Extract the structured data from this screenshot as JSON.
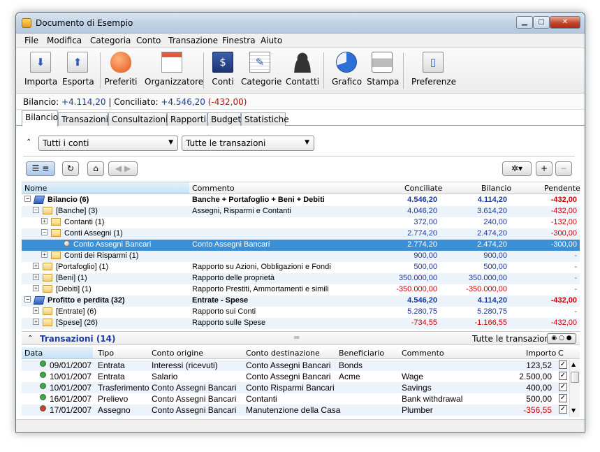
{
  "window": {
    "title": "Documento di Esempio"
  },
  "menu": [
    "File",
    "Modifica",
    "Categoria",
    "Conto",
    "Transazione",
    "Finestra",
    "Aiuto"
  ],
  "toolbar": [
    {
      "label": "Importa",
      "icon": "import-icon"
    },
    {
      "label": "Esporta",
      "icon": "export-icon"
    },
    {
      "label": "Preferiti",
      "icon": "heart-icon"
    },
    {
      "label": "Organizzatore",
      "icon": "calendar-icon"
    },
    {
      "label": "Conti",
      "icon": "accounts-book-icon"
    },
    {
      "label": "Categorie",
      "icon": "notepad-icon"
    },
    {
      "label": "Contatti",
      "icon": "person-icon"
    },
    {
      "label": "Grafico",
      "icon": "pie-chart-icon"
    },
    {
      "label": "Stampa",
      "icon": "printer-icon"
    },
    {
      "label": "Preferenze",
      "icon": "switch-icon"
    }
  ],
  "balance": {
    "label1": "Bilancio:",
    "value1": "+4.114,20",
    "sep": "|",
    "label2": "Conciliato:",
    "value2": "+4.546,20",
    "diff": "(-432,00)"
  },
  "tabs": [
    "Bilancio",
    "Transazioni",
    "Consultazioni",
    "Rapporti",
    "Budget",
    "Statistiche"
  ],
  "filters": {
    "accounts": "Tutti i conti",
    "transactions": "Tutte le transazioni"
  },
  "accounts": {
    "columns": [
      "Nome",
      "Commento",
      "Conciliate",
      "Bilancio",
      "Pendente"
    ],
    "rows": [
      {
        "name": "Bilancio (6)",
        "comment": "Banche + Portafoglio + Beni + Debiti",
        "conc": "4.546,20",
        "bal": "4.114,20",
        "pend": "-432,00",
        "bold": true,
        "indent": 0,
        "type": "book",
        "tog": "−"
      },
      {
        "name": "[Banche] (3)",
        "comment": "Assegni, Risparmi e Contanti",
        "conc": "4.046,20",
        "bal": "3.614,20",
        "pend": "-432,00",
        "indent": 1,
        "type": "folder",
        "tog": "−"
      },
      {
        "name": "Contanti (1)",
        "comment": "",
        "conc": "372,00",
        "bal": "240,00",
        "pend": "-132,00",
        "indent": 2,
        "type": "folder",
        "tog": "+"
      },
      {
        "name": "Conti Assegni (1)",
        "comment": "",
        "conc": "2.774,20",
        "bal": "2.474,20",
        "pend": "-300,00",
        "indent": 2,
        "type": "folder",
        "tog": "−"
      },
      {
        "name": "Conto Assegni Bancari",
        "comment": "Conto Assegni Bancari",
        "conc": "2.774,20",
        "bal": "2.474,20",
        "pend": "-300,00",
        "indent": 3,
        "type": "dot",
        "sel": true
      },
      {
        "name": "Conti dei Risparmi (1)",
        "comment": "",
        "conc": "900,00",
        "bal": "900,00",
        "pend": "-",
        "indent": 2,
        "type": "folder",
        "tog": "+"
      },
      {
        "name": "[Portafoglio] (1)",
        "comment": "Rapporto su Azioni, Obbligazioni e Fondi",
        "conc": "500,00",
        "bal": "500,00",
        "pend": "-",
        "indent": 1,
        "type": "folder",
        "tog": "+"
      },
      {
        "name": "[Beni] (1)",
        "comment": "Rapporto delle proprietà",
        "conc": "350.000,00",
        "bal": "350.000,00",
        "pend": "-",
        "indent": 1,
        "type": "folder",
        "tog": "+"
      },
      {
        "name": "[Debiti] (1)",
        "comment": "Rapporto Prestiti, Ammortamenti e simili",
        "conc": "-350.000,00",
        "bal": "-350.000,00",
        "pend": "-",
        "indent": 1,
        "type": "folder",
        "tog": "+",
        "neg": true
      },
      {
        "name": "Profitto e perdita (32)",
        "comment": "Entrate - Spese",
        "conc": "4.546,20",
        "bal": "4.114,20",
        "pend": "-432,00",
        "bold": true,
        "indent": 0,
        "type": "book",
        "tog": "−"
      },
      {
        "name": "[Entrate] (6)",
        "comment": "Rapporto sui Conti",
        "conc": "5.280,75",
        "bal": "5.280,75",
        "pend": "-",
        "indent": 1,
        "type": "folder",
        "tog": "+"
      },
      {
        "name": "[Spese] (26)",
        "comment": "Rapporto sulle Spese",
        "conc": "-734,55",
        "bal": "-1.166,55",
        "pend": "-432,00",
        "indent": 1,
        "type": "folder",
        "tog": "+",
        "neg": true
      }
    ]
  },
  "transactions": {
    "title": "Transazioni (14)",
    "filter": "Tutte le transazioni",
    "columns": [
      "Data",
      "Tipo",
      "Conto origine",
      "Conto destinazione",
      "Beneficiario",
      "Commento",
      "Importo",
      "C"
    ],
    "rows": [
      {
        "date": "09/01/2007",
        "type": "Entrata",
        "from": "Interessi (ricevuti)",
        "to": "Conto Assegni Bancari",
        "payee": "Bonds",
        "comment": "",
        "amount": "123,52",
        "status": "#3aa84a"
      },
      {
        "date": "10/01/2007",
        "type": "Entrata",
        "from": "Salario",
        "to": "Conto Assegni Bancari",
        "payee": "Acme",
        "comment": "Wage",
        "amount": "2.500,00",
        "status": "#3aa84a"
      },
      {
        "date": "10/01/2007",
        "type": "Trasferimento",
        "from": "Conto Assegni Bancari",
        "to": "Conto Risparmi Bancari",
        "payee": "",
        "comment": "Savings",
        "amount": "400,00",
        "status": "#3aa84a"
      },
      {
        "date": "16/01/2007",
        "type": "Prelievo",
        "from": "Conto Assegni Bancari",
        "to": "Contanti",
        "payee": "",
        "comment": "Bank withdrawal",
        "amount": "500,00",
        "status": "#3aa84a"
      },
      {
        "date": "17/01/2007",
        "type": "Assegno",
        "from": "Conto Assegni Bancari",
        "to": "Manutenzione della Casa",
        "payee": "",
        "comment": "Plumber",
        "amount": "-356,55",
        "status": "#d63a2a",
        "neg": true
      }
    ]
  }
}
